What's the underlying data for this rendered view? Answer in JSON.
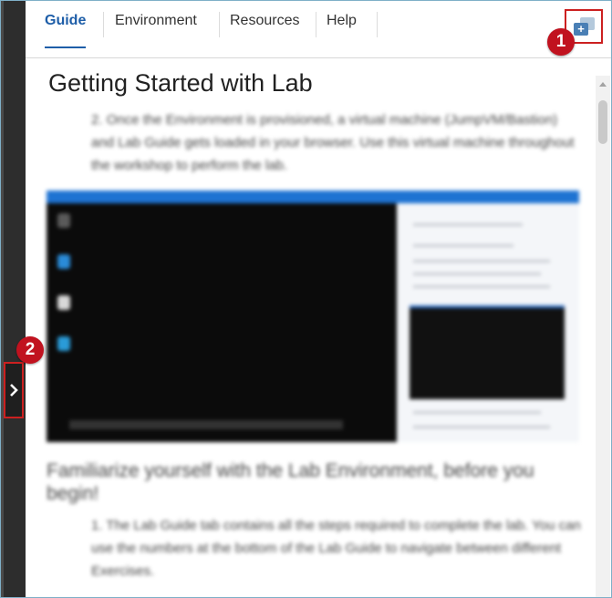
{
  "tabs": [
    {
      "label": "Guide",
      "active": true
    },
    {
      "label": "Environment",
      "active": false
    },
    {
      "label": "Resources",
      "active": false
    },
    {
      "label": "Help",
      "active": false
    }
  ],
  "popout_icon": "popout-window-icon",
  "callouts": {
    "one": "1",
    "two": "2"
  },
  "expand_icon": "chevron-right-icon",
  "content": {
    "title": "Getting Started with Lab",
    "step_prefix": "2.",
    "para1": "Once the Environment is provisioned, a virtual machine (JumpVM/Bastion) and Lab Guide gets loaded in your browser. Use this virtual machine throughout the workshop to perform the lab.",
    "heading2": "Familiarize yourself with the Lab Environment, before you begin!",
    "step2_prefix": "1.",
    "para2": "The Lab Guide tab contains all the steps required to complete the lab. You can use the numbers at the bottom of the Lab Guide to navigate between different Exercises."
  },
  "colors": {
    "accent": "#1e5ea8",
    "callout": "#c1121f",
    "rail": "#2d2d2d"
  }
}
